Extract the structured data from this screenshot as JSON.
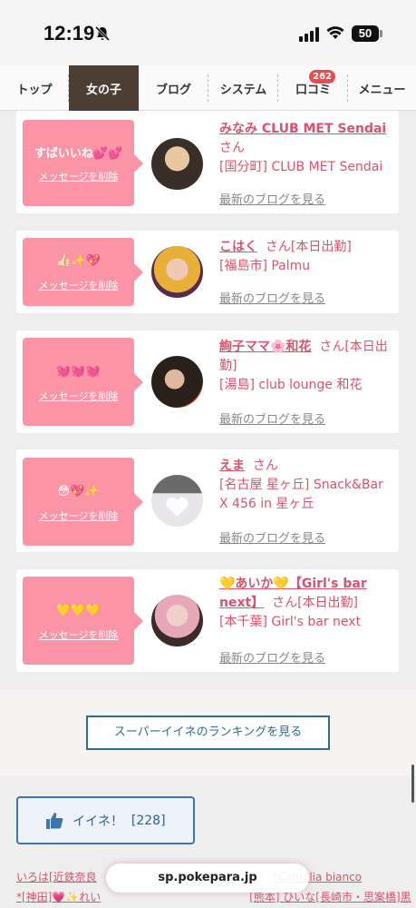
{
  "status": {
    "time": "12:19",
    "battery": "50"
  },
  "nav": {
    "items": [
      {
        "label": "トップ"
      },
      {
        "label": "女の子"
      },
      {
        "label": "ブログ"
      },
      {
        "label": "システム"
      },
      {
        "label": "口コミ",
        "badge": "262"
      },
      {
        "label": "メニュー"
      }
    ]
  },
  "cards": [
    {
      "message": "すばいいね💕💕",
      "delete_label": "メッセージを削除",
      "name": "みなみ CLUB MET Sendai",
      "san": "さん",
      "shop": "[国分町] CLUB MET Sendai",
      "blog": "最新のブログを見る"
    },
    {
      "message": "👍🏻✨💖",
      "delete_label": "メッセージを削除",
      "name": "こはく",
      "san": "さん[本日出勤]",
      "shop": "[福島市] Palmu",
      "blog": "最新のブログを見る"
    },
    {
      "message": "💓💓💓",
      "delete_label": "メッセージを削除",
      "name": "絢子ママ🌸和花",
      "san": "さん[本日出勤]",
      "shop": "[湯島] club lounge 和花",
      "blog": "最新のブログを見る"
    },
    {
      "message": "😳💖✨",
      "delete_label": "メッセージを削除",
      "name": "えま",
      "san": "さん",
      "shop": "[名古屋 星ヶ丘] Snack&Bar X 456 in 星ヶ丘",
      "blog": "最新のブログを見る"
    },
    {
      "message": "💛💛💛",
      "delete_label": "メッセージを削除",
      "name": "💛あいか💛【Girl's bar next】",
      "san": "さん[本日出勤]",
      "shop": "[本千葉] Girl's bar next",
      "blog": "最新のブログを見る"
    }
  ],
  "ranking_button": "スーパーイイネのランキングを見る",
  "iine": {
    "label": "イイネ！",
    "count": "[228]"
  },
  "footer_links": {
    "line1a": "いろは[近鉄奈良",
    "line1b": "*Camelia bianco",
    "line2a": "*[神田]💗✨れい",
    "line2b": "[熊本] ひいな[長崎市・思案橋]黒"
  },
  "url": "sp.pokepara.jp",
  "colors": {
    "accent_pink": "#fc94a8",
    "link_pink": "#d8536b",
    "nav_active": "#4a3e35",
    "button_blue": "#2d6f8e"
  }
}
